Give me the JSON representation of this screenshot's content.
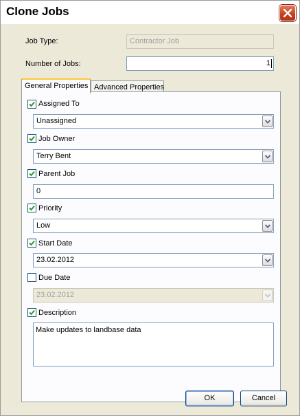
{
  "window": {
    "title": "Clone Jobs"
  },
  "form": {
    "job_type_label": "Job Type:",
    "job_type_value": "Contractor Job",
    "num_jobs_label": "Number of Jobs:",
    "num_jobs_value": "1"
  },
  "tabs": [
    {
      "label": "General Properties",
      "active": true
    },
    {
      "label": "Advanced Properties",
      "active": false
    }
  ],
  "general": {
    "assigned_to": {
      "label": "Assigned To",
      "checked": true,
      "value": "Unassigned"
    },
    "job_owner": {
      "label": "Job Owner",
      "checked": true,
      "value": "Terry Bent"
    },
    "parent_job": {
      "label": "Parent Job",
      "checked": true,
      "value": "0"
    },
    "priority": {
      "label": "Priority",
      "checked": true,
      "value": "Low"
    },
    "start_date": {
      "label": "Start Date",
      "checked": true,
      "value": "23.02.2012"
    },
    "due_date": {
      "label": "Due Date",
      "checked": false,
      "value": "23.02.2012"
    },
    "description": {
      "label": "Description",
      "checked": true,
      "value": "Make updates to landbase data"
    }
  },
  "buttons": {
    "ok": "OK",
    "cancel": "Cancel"
  },
  "icons": {
    "close": "close-icon",
    "checkbox_check": "check-icon",
    "dropdown": "chevron-down-icon"
  },
  "colors": {
    "close_button": "#c4401f",
    "tab_highlight": "#ffc83c",
    "input_border": "#7f9db9",
    "dialog_bg": "#ece9d8"
  }
}
